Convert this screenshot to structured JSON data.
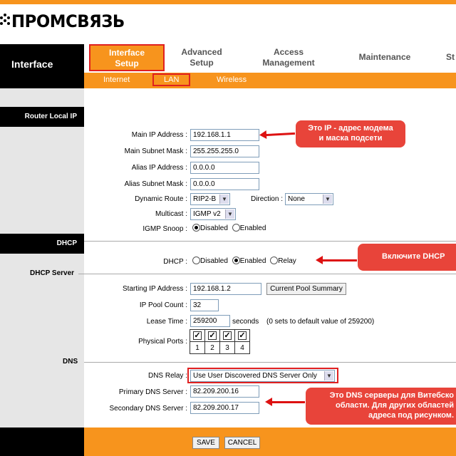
{
  "brand": {
    "name": "ПРОМСВЯЗЬ"
  },
  "nav": {
    "section_label": "Interface",
    "tabs": [
      {
        "label_line1": "Interface",
        "label_line2": "Setup"
      },
      {
        "label_line1": "Advanced",
        "label_line2": "Setup"
      },
      {
        "label_line1": "Access",
        "label_line2": "Management"
      },
      {
        "label_line1": "Maintenance",
        "label_line2": ""
      },
      {
        "label_line1": "St",
        "label_line2": ""
      }
    ],
    "subtabs": [
      "Internet",
      "LAN",
      "Wireless"
    ]
  },
  "sidebar": {
    "router_local_ip": "Router Local IP",
    "dhcp": "DHCP",
    "dhcp_server": "DHCP Server",
    "dns": "DNS"
  },
  "router": {
    "main_ip_label": "Main IP Address",
    "main_ip": "192.168.1.1",
    "subnet_label": "Main Subnet Mask",
    "subnet": "255.255.255.0",
    "alias_ip_label": "Alias IP Address",
    "alias_ip": "0.0.0.0",
    "alias_subnet_label": "Alias Subnet Mask",
    "alias_subnet": "0.0.0.0",
    "dynamic_route_label": "Dynamic Route",
    "dynamic_route": "RIP2-B",
    "direction_label": "Direction",
    "direction": "None",
    "multicast_label": "Multicast",
    "multicast": "IGMP v2",
    "igmp_snoop_label": "IGMP Snoop",
    "igmp_disabled": "Disabled",
    "igmp_enabled": "Enabled"
  },
  "dhcp": {
    "label": "DHCP",
    "disabled": "Disabled",
    "enabled": "Enabled",
    "relay": "Relay"
  },
  "dhcp_server": {
    "start_ip_label": "Starting IP Address",
    "start_ip": "192.168.1.2",
    "pool_summary_button": "Current Pool Summary",
    "pool_count_label": "IP Pool Count",
    "pool_count": "32",
    "lease_label": "Lease Time",
    "lease_time": "259200",
    "lease_unit": "seconds",
    "lease_note": "(0 sets to default value of 259200)",
    "ports_label": "Physical Ports",
    "ports": [
      "1",
      "2",
      "3",
      "4"
    ]
  },
  "dns": {
    "relay_label": "DNS Relay",
    "relay": "Use User Discovered DNS Server Only",
    "primary_label": "Primary DNS Server",
    "primary": "82.209.200.16",
    "secondary_label": "Secondary DNS Server",
    "secondary": "82.209.200.17"
  },
  "buttons": {
    "save": "SAVE",
    "cancel": "CANCEL"
  },
  "annotations": {
    "ip_note_line1": "Это IP - адрес модема",
    "ip_note_line2": "и маска подсети",
    "dhcp_note": "Включите DHCP",
    "dns_note_line1": "Это DNS серверы для Витебско",
    "dns_note_line2": "области. Для других областей",
    "dns_note_line3": "адреса под рисунком."
  },
  "colors": {
    "accent": "#f7941d",
    "callout": "#e8443a",
    "highlight": "#e02020"
  }
}
